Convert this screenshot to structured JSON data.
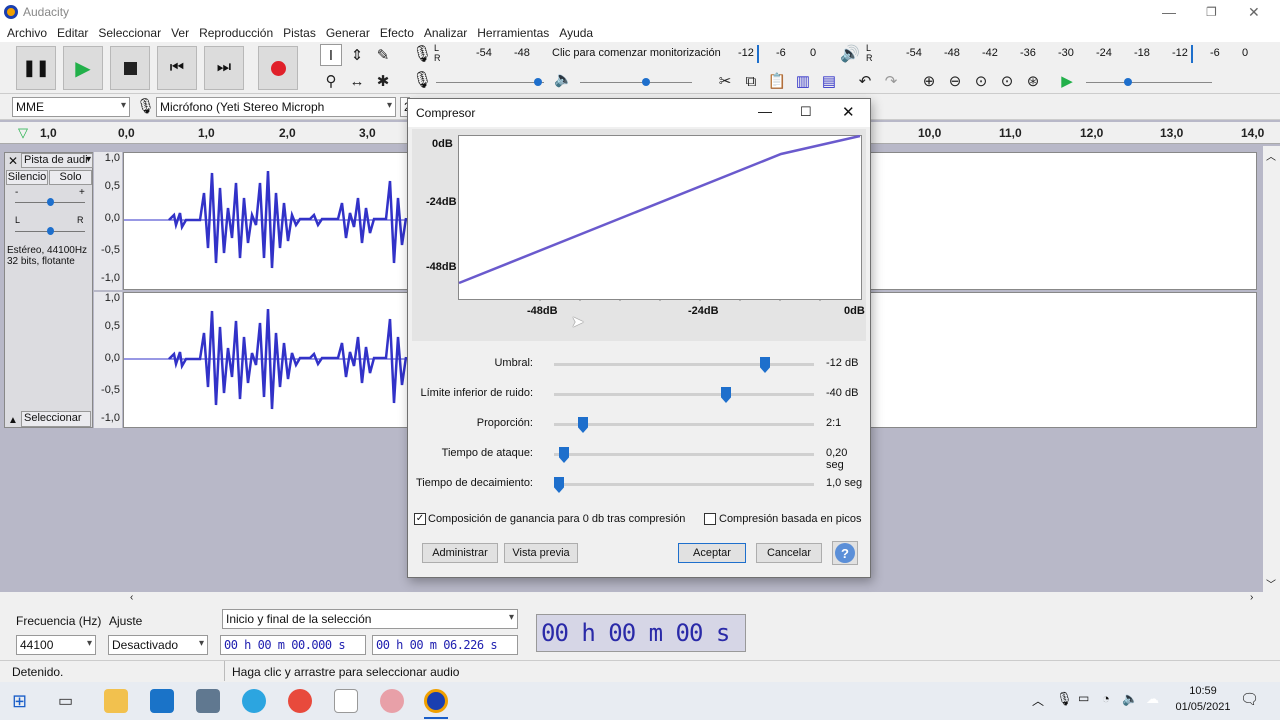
{
  "app": {
    "title": "Audacity"
  },
  "menu": [
    "Archivo",
    "Editar",
    "Seleccionar",
    "Ver",
    "Reproducción",
    "Pistas",
    "Generar",
    "Efecto",
    "Analizar",
    "Herramientas",
    "Ayuda"
  ],
  "meters": {
    "rec_label": "Clic para comenzar monitorización",
    "rec_ticks": [
      "-54",
      "-48",
      "-12",
      "-6",
      "0"
    ],
    "play_ticks": [
      "-54",
      "-48",
      "-42",
      "-36",
      "-30",
      "-24",
      "-18",
      "-12",
      "-6",
      "0"
    ],
    "lr": {
      "l": "L",
      "r": "R"
    }
  },
  "device": {
    "host": "MME",
    "input": "Micrófono (Yeti Stereo Microph",
    "channels": "2"
  },
  "ruler": {
    "left": "1,0",
    "zero": "0,0",
    "ticks": [
      "1,0",
      "2,0",
      "3,0"
    ],
    "right_ticks": [
      "10,0",
      "11,0",
      "12,0",
      "13,0",
      "14,0"
    ]
  },
  "track": {
    "name": "Pista de audi",
    "mute": "Silencio",
    "solo": "Solo",
    "gain_minus": "-",
    "gain_plus": "+",
    "pan_l": "L",
    "pan_r": "R",
    "info1": "Estéreo, 44100Hz",
    "info2": "32 bits, flotante",
    "select": "Seleccionar",
    "scale": [
      "1,0",
      "0,5",
      "0,0",
      "-0,5",
      "-1,0"
    ]
  },
  "dialog": {
    "title": "Compresor",
    "graph": {
      "y_labels": [
        "0dB",
        "-24dB",
        "-48dB"
      ],
      "x_labels": [
        "-48dB",
        "-24dB",
        "0dB"
      ]
    },
    "controls": [
      {
        "label": "Umbral:",
        "value": "-12 dB",
        "level": 0.81
      },
      {
        "label": "Límite inferior de ruido:",
        "value": "-40 dB",
        "level": 0.66
      },
      {
        "label": "Proporción:",
        "value": "2:1",
        "level": 0.11
      },
      {
        "label": "Tiempo de ataque:",
        "value": "0,20 seg",
        "level": 0.04
      },
      {
        "label": "Tiempo de decaimiento:",
        "value": "1,0 seg",
        "level": 0.02
      }
    ],
    "check_makeup": {
      "label": "Composición de ganancia para 0 db tras compresión",
      "checked": true
    },
    "check_peaks": {
      "label": "Compresión basada en picos",
      "checked": false
    },
    "buttons": {
      "manage": "Administrar",
      "preview": "Vista previa",
      "ok": "Aceptar",
      "cancel": "Cancelar",
      "help": "?"
    }
  },
  "selection": {
    "rate_label": "Frecuencia (Hz)",
    "snap_label": "Ajuste",
    "rate": "44100",
    "snap": "Desactivado",
    "mode": "Inicio y final de la selección",
    "start": "00 h 00 m 00.000 s",
    "end": "00 h 00 m 06.226 s",
    "position": "00 h 00 m 00 s"
  },
  "status": {
    "state": "Detenido.",
    "hint": "Haga clic y arrastre para seleccionar audio"
  },
  "taskbar": {
    "time": "10:59",
    "date": "01/05/2021"
  },
  "colors": {
    "accent": "#1e6fcc",
    "wave": "#3232c8",
    "curve": "#6a5acd"
  }
}
